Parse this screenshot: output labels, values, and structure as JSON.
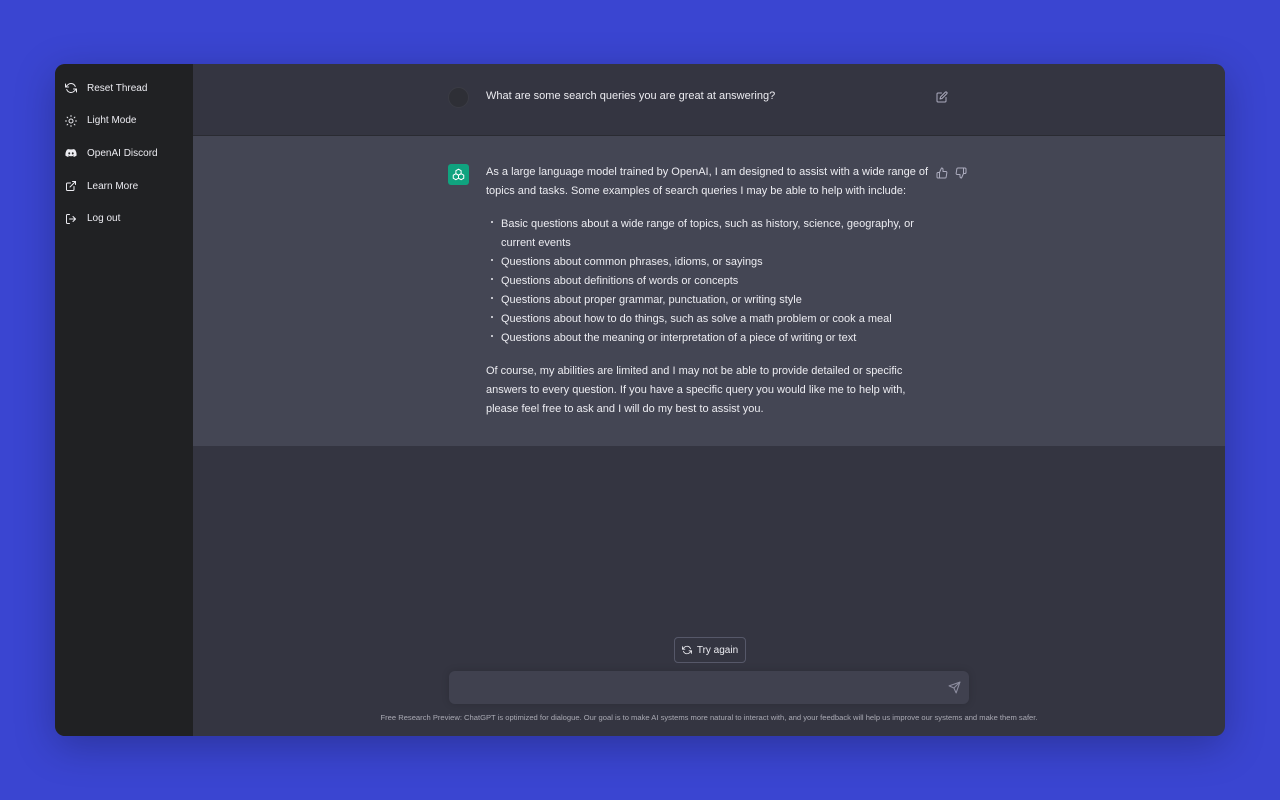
{
  "sidebar": {
    "items": [
      {
        "label": "Reset Thread",
        "icon": "refresh-icon"
      },
      {
        "label": "Light Mode",
        "icon": "sun-icon"
      },
      {
        "label": "OpenAI Discord",
        "icon": "discord-icon"
      },
      {
        "label": "Learn More",
        "icon": "external-link-icon"
      },
      {
        "label": "Log out",
        "icon": "logout-icon"
      }
    ]
  },
  "conversation": {
    "user_message": "What are some search queries you are great at answering?",
    "assistant": {
      "intro": "As a large language model trained by OpenAI, I am designed to assist with a wide range of topics and tasks. Some examples of search queries I may be able to help with include:",
      "bullets": [
        "Basic questions about a wide range of topics, such as history, science, geography, or current events",
        "Questions about common phrases, idioms, or sayings",
        "Questions about definitions of words or concepts",
        "Questions about proper grammar, punctuation, or writing style",
        "Questions about how to do things, such as solve a math problem or cook a meal",
        "Questions about the meaning or interpretation of a piece of writing or text"
      ],
      "outro": "Of course, my abilities are limited and I may not be able to provide detailed or specific answers to every question. If you have a specific query you would like me to help with, please feel free to ask and I will do my best to assist you."
    }
  },
  "actions": {
    "try_again_label": "Try again"
  },
  "input": {
    "value": "",
    "placeholder": ""
  },
  "footer": {
    "note": "Free Research Preview: ChatGPT is optimized for dialogue. Our goal is to make AI systems more natural to interact with, and your feedback will help us improve our systems and make them safer."
  },
  "colors": {
    "background": "#3a45d1",
    "sidebar": "#202123",
    "main": "#343541",
    "assistant_row": "#444654",
    "brand_green": "#10a37f"
  }
}
